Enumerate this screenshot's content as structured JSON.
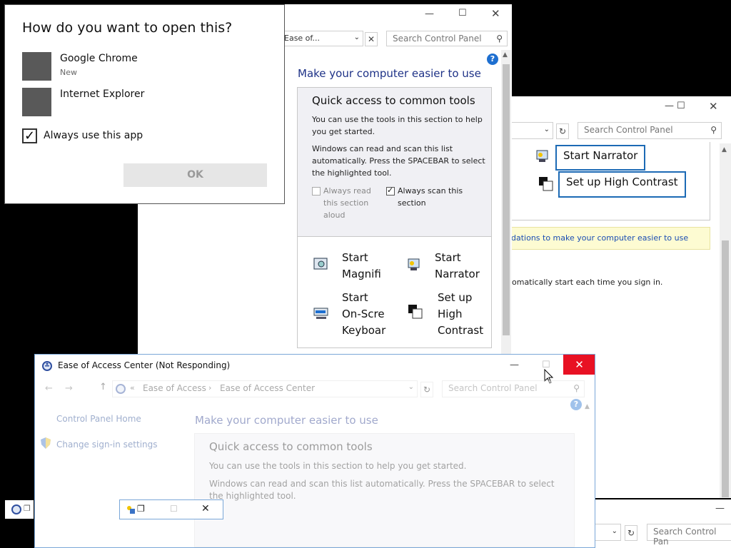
{
  "colors": {
    "heading_blue": "#1e3287",
    "close_red": "#e81123",
    "highlight_blue": "#1c6ab5",
    "notice_yellow": "#fdfbd2"
  },
  "open_with_dialog": {
    "title": "How do you want to open this?",
    "apps": [
      {
        "name": "Google Chrome",
        "sub": "New"
      },
      {
        "name": "Internet Explorer",
        "sub": ""
      }
    ],
    "always_use_label": "Always use this app",
    "always_use_checked": true,
    "ok_label": "OK"
  },
  "win_back": {
    "address": "Ease of...",
    "search_placeholder": "Search Control Panel",
    "heading": "Make your computer easier to use",
    "quick_title": "Quick access to common tools",
    "quick_p1": "You can use the tools in this section to help you get started.",
    "quick_p2": "Windows can read and scan this list automatically.  Press the SPACEBAR to select the highlighted tool.",
    "cb_read_label": "Always read this section aloud",
    "cb_scan_label": "Always scan this section",
    "tools": [
      {
        "label": "Start Magnifi",
        "icon": "magnifier-icon"
      },
      {
        "label": "Start Narrator",
        "icon": "narrator-icon"
      },
      {
        "label": "Start On-Scre Keyboar",
        "icon": "keyboard-icon"
      },
      {
        "label": "Set up High Contrast",
        "icon": "contrast-icon"
      }
    ]
  },
  "win_right": {
    "search_placeholder": "Search Control Panel",
    "start_narrator": "Start Narrator",
    "setup_contrast": "Set up High Contrast",
    "recommend_text": "dations to make your computer easier to use",
    "auto_start_text": "omatically start each time you sign in."
  },
  "win_front": {
    "title": "Ease of Access Center (Not Responding)",
    "breadcrumb_root": "Ease of Access",
    "breadcrumb_current": "Ease of Access Center",
    "search_placeholder": "Search Control Panel",
    "side_home": "Control Panel Home",
    "side_signin": "Change sign-in settings",
    "heading": "Make your computer easier to use",
    "quick_title": "Quick access to common tools",
    "quick_p1": "You can use the tools in this section to help you get started.",
    "quick_p2": "Windows can read and scan this list automatically.  Press the SPACEBAR to select the highlighted tool."
  },
  "win_bottom_right": {
    "search_placeholder": "Search Control Pan"
  }
}
